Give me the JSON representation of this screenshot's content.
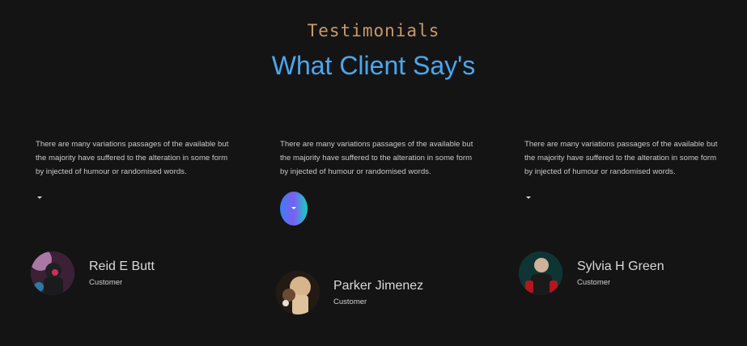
{
  "header": {
    "eyebrow": "Testimonials",
    "title": "What Client Say's"
  },
  "testimonials": [
    {
      "text": "There are many variations passages of the available but the majority have suffered to the alteration in some form by injected of humour or randomised words.",
      "name": "Reid E Butt",
      "role": "Customer",
      "avatar_icon": "person-avatar-icon",
      "active": false
    },
    {
      "text": "There are many variations passages of the available but the majority have suffered to the alteration in some form by injected of humour or randomised words.",
      "name": "Parker Jimenez",
      "role": "Customer",
      "avatar_icon": "person-avatar-icon",
      "active": true
    },
    {
      "text": "There are many variations passages of the available but the majority have suffered to the alteration in some form by injected of humour or randomised words.",
      "name": "Sylvia H Green",
      "role": "Customer",
      "avatar_icon": "person-avatar-icon",
      "active": false
    }
  ],
  "colors": {
    "background": "#151415",
    "eyebrow": "#c79a6b",
    "title": "#4aa7ee",
    "text": "#c9c9c9"
  }
}
